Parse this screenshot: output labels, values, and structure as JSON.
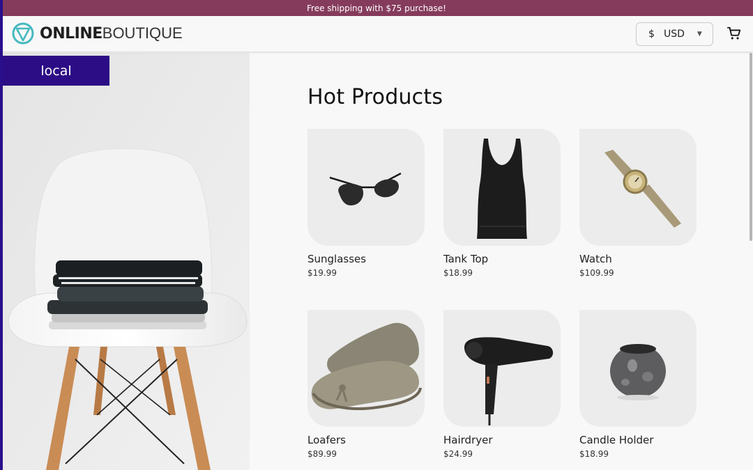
{
  "banner": {
    "text": "Free shipping with $75 purchase!"
  },
  "header": {
    "logo_bold": "ONLINE",
    "logo_light": "BOUTIQUE",
    "currency": {
      "symbol": "$",
      "code": "USD"
    }
  },
  "environment_badge": "local",
  "main": {
    "title": "Hot Products",
    "products": [
      {
        "name": "Sunglasses",
        "price": "$19.99",
        "icon": "sunglasses"
      },
      {
        "name": "Tank Top",
        "price": "$18.99",
        "icon": "tank-top"
      },
      {
        "name": "Watch",
        "price": "$109.99",
        "icon": "watch"
      },
      {
        "name": "Loafers",
        "price": "$89.99",
        "icon": "loafers"
      },
      {
        "name": "Hairdryer",
        "price": "$24.99",
        "icon": "hairdryer"
      },
      {
        "name": "Candle Holder",
        "price": "$18.99",
        "icon": "candle-holder"
      }
    ]
  },
  "colors": {
    "banner": "#853b5c",
    "badge": "#2c0d86",
    "logo_accent": "#45b9c0"
  }
}
